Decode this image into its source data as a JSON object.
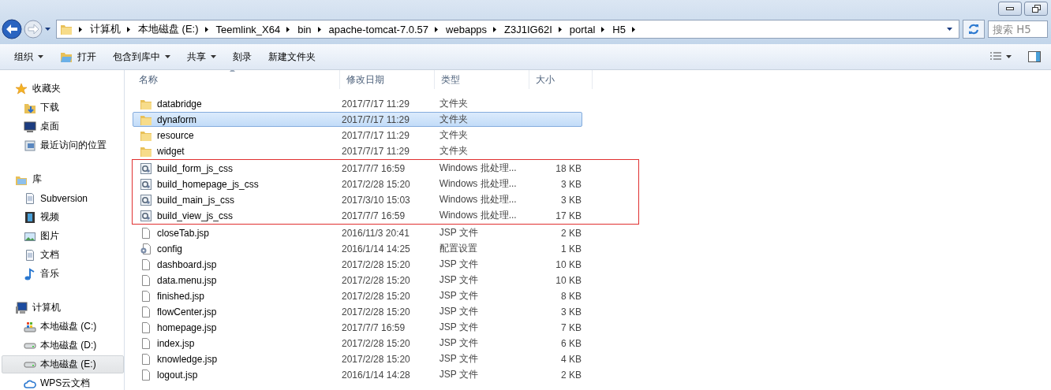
{
  "address_bar": {
    "crumbs": [
      "计算机",
      "本地磁盘 (E:)",
      "Teemlink_X64",
      "bin",
      "apache-tomcat-7.0.57",
      "webapps",
      "Z3J1IG62I",
      "portal",
      "H5"
    ]
  },
  "search": {
    "placeholder": "搜索 H5"
  },
  "toolbar": [
    {
      "label": "组织",
      "kind": "menu"
    },
    {
      "label": "打开",
      "kind": "open"
    },
    {
      "label": "包含到库中",
      "kind": "menu"
    },
    {
      "label": "共享",
      "kind": "menu"
    },
    {
      "label": "刻录",
      "kind": "plain"
    },
    {
      "label": "新建文件夹",
      "kind": "plain"
    }
  ],
  "sidebar": [
    {
      "label": "收藏夹",
      "kind": "star",
      "children": [
        {
          "label": "下载",
          "kind": "download",
          "selected": false
        },
        {
          "label": "桌面",
          "kind": "desktop",
          "selected": false
        },
        {
          "label": "最近访问的位置",
          "kind": "recent",
          "selected": false
        }
      ]
    },
    {
      "label": "库",
      "kind": "library",
      "children": [
        {
          "label": "Subversion",
          "kind": "doc",
          "selected": false
        },
        {
          "label": "视频",
          "kind": "video",
          "selected": false
        },
        {
          "label": "图片",
          "kind": "image",
          "selected": false
        },
        {
          "label": "文档",
          "kind": "doc",
          "selected": false
        },
        {
          "label": "音乐",
          "kind": "music",
          "selected": false
        }
      ]
    },
    {
      "label": "计算机",
      "kind": "computer",
      "children": [
        {
          "label": "本地磁盘 (C:)",
          "kind": "sysdrive",
          "selected": false
        },
        {
          "label": "本地磁盘 (D:)",
          "kind": "drive",
          "selected": false
        },
        {
          "label": "本地磁盘 (E:)",
          "kind": "drive",
          "selected": true
        },
        {
          "label": "WPS云文档",
          "kind": "cloud",
          "selected": false
        }
      ]
    }
  ],
  "table": {
    "columns": [
      "名称",
      "修改日期",
      "类型",
      "大小"
    ],
    "rows": [
      {
        "name": "databridge",
        "date": "2017/7/17 11:29",
        "type": "文件夹",
        "kind": "folder",
        "selected": false,
        "marked": false
      },
      {
        "name": "dynaform",
        "date": "2017/7/17 11:29",
        "type": "文件夹",
        "kind": "folder",
        "selected": true,
        "marked": false
      },
      {
        "name": "resource",
        "date": "2017/7/17 11:29",
        "type": "文件夹",
        "kind": "folder",
        "selected": false,
        "marked": false
      },
      {
        "name": "widget",
        "date": "2017/7/17 11:29",
        "type": "文件夹",
        "kind": "folder",
        "selected": false,
        "marked": false
      },
      {
        "name": "build_form_js_css",
        "date": "2017/7/7 16:59",
        "type": "Windows 批处理...",
        "size": "18 KB",
        "kind": "batch",
        "selected": false,
        "marked": true
      },
      {
        "name": "build_homepage_js_css",
        "date": "2017/2/28 15:20",
        "type": "Windows 批处理...",
        "size": "3 KB",
        "kind": "batch",
        "selected": false,
        "marked": true
      },
      {
        "name": "build_main_js_css",
        "date": "2017/3/10 15:03",
        "type": "Windows 批处理...",
        "size": "3 KB",
        "kind": "batch",
        "selected": false,
        "marked": true
      },
      {
        "name": "build_view_js_css",
        "date": "2017/7/7 16:59",
        "type": "Windows 批处理...",
        "size": "17 KB",
        "kind": "batch",
        "selected": false,
        "marked": true
      },
      {
        "name": "closeTab.jsp",
        "date": "2016/11/3 20:41",
        "type": "JSP 文件",
        "size": "2 KB",
        "kind": "file",
        "selected": false,
        "marked": false
      },
      {
        "name": "config",
        "date": "2016/1/14 14:25",
        "type": "配置设置",
        "size": "1 KB",
        "kind": "config",
        "selected": false,
        "marked": false
      },
      {
        "name": "dashboard.jsp",
        "date": "2017/2/28 15:20",
        "type": "JSP 文件",
        "size": "10 KB",
        "kind": "file",
        "selected": false,
        "marked": false
      },
      {
        "name": "data.menu.jsp",
        "date": "2017/2/28 15:20",
        "type": "JSP 文件",
        "size": "10 KB",
        "kind": "file",
        "selected": false,
        "marked": false
      },
      {
        "name": "finished.jsp",
        "date": "2017/2/28 15:20",
        "type": "JSP 文件",
        "size": "8 KB",
        "kind": "file",
        "selected": false,
        "marked": false
      },
      {
        "name": "flowCenter.jsp",
        "date": "2017/2/28 15:20",
        "type": "JSP 文件",
        "size": "3 KB",
        "kind": "file",
        "selected": false,
        "marked": false
      },
      {
        "name": "homepage.jsp",
        "date": "2017/7/7 16:59",
        "type": "JSP 文件",
        "size": "7 KB",
        "kind": "file",
        "selected": false,
        "marked": false
      },
      {
        "name": "index.jsp",
        "date": "2017/2/28 15:20",
        "type": "JSP 文件",
        "size": "6 KB",
        "kind": "file",
        "selected": false,
        "marked": false
      },
      {
        "name": "knowledge.jsp",
        "date": "2017/2/28 15:20",
        "type": "JSP 文件",
        "size": "4 KB",
        "kind": "file",
        "selected": false,
        "marked": false
      },
      {
        "name": "logout.jsp",
        "date": "2016/1/14 14:28",
        "type": "JSP 文件",
        "size": "2 KB",
        "kind": "file",
        "selected": false,
        "marked": false
      }
    ]
  }
}
